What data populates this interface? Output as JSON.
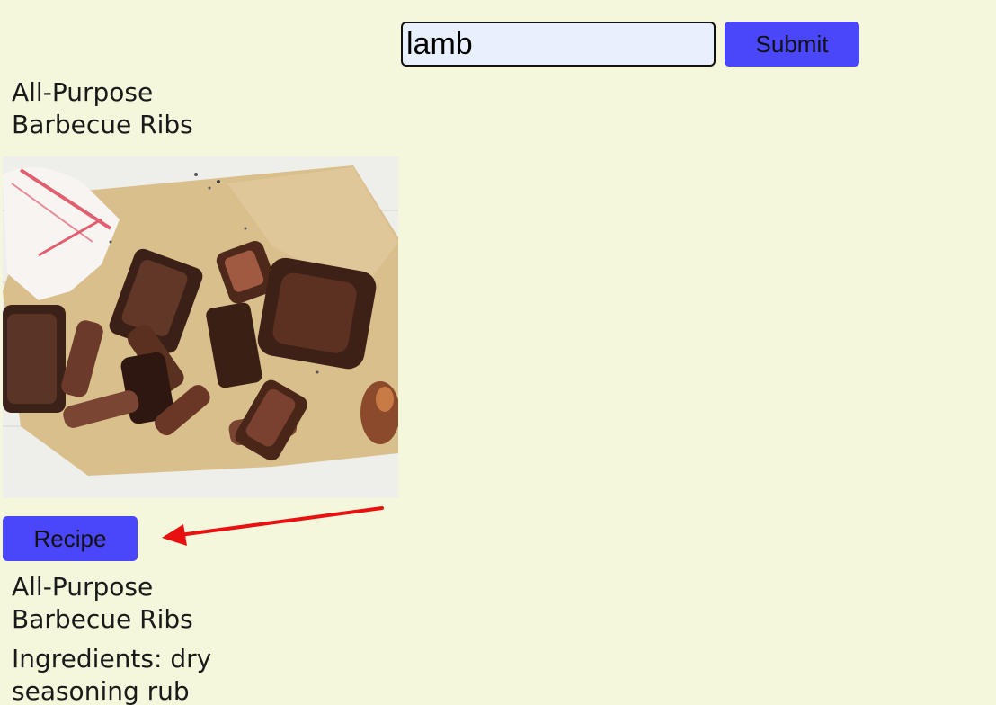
{
  "search": {
    "value": "lamb",
    "submit_label": "Submit"
  },
  "recipe_card": {
    "title": "All-Purpose Barbecue Ribs",
    "image_icon": "barbecue-ribs-photo",
    "recipe_button_label": "Recipe",
    "detail_title": "All-Purpose Barbecue Ribs",
    "ingredients": "Ingredients: dry seasoning rub"
  },
  "annotation": {
    "arrow_color": "#e81010"
  },
  "colors": {
    "background": "#f4f7dc",
    "button": "#4a47fb",
    "input_background": "#e8f0fe"
  }
}
